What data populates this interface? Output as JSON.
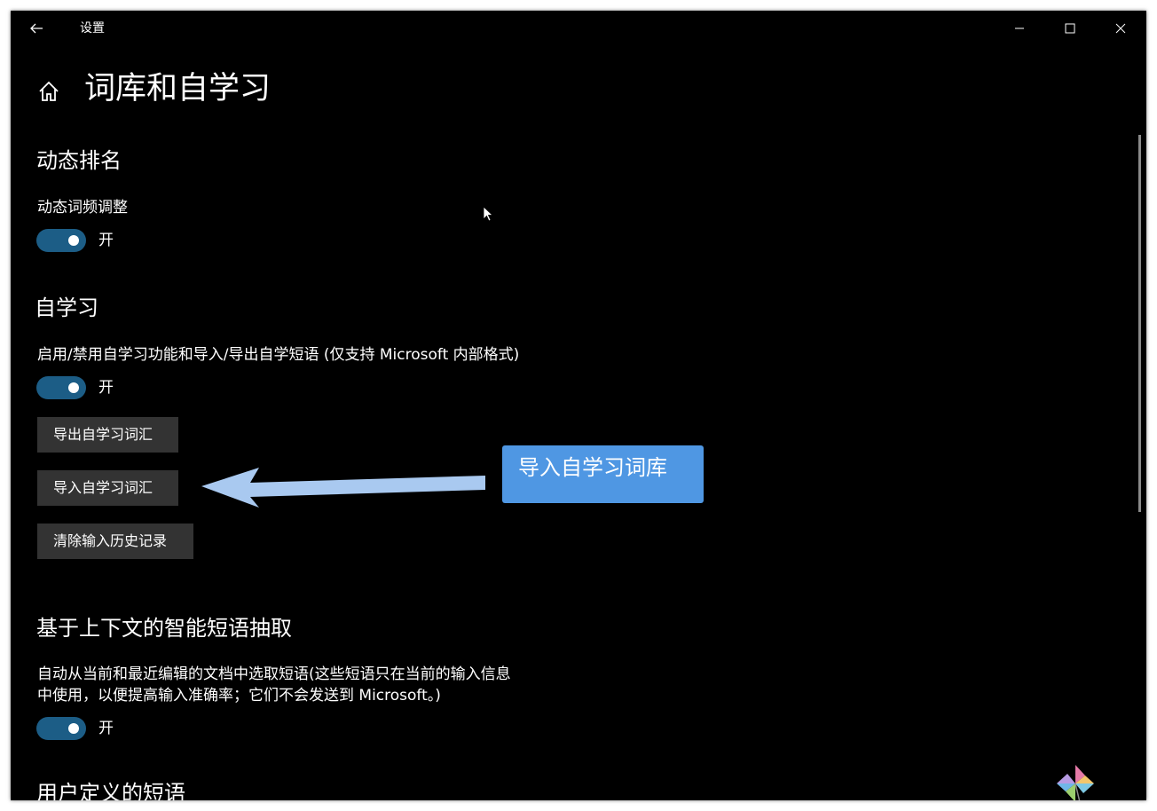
{
  "window": {
    "title": "设置"
  },
  "page": {
    "title": "词库和自学习"
  },
  "dynamic_ranking": {
    "heading": "动态排名",
    "setting_label": "动态词频调整",
    "toggle_state": "开"
  },
  "self_learning": {
    "heading": "自学习",
    "setting_label": "启用/禁用自学习功能和导入/导出自学短语 (仅支持 Microsoft 内部格式)",
    "toggle_state": "开",
    "export_button": "导出自学习词汇",
    "import_button": "导入自学习词汇",
    "clear_button": "清除输入历史记录"
  },
  "context_phrases": {
    "heading": "基于上下文的智能短语抽取",
    "description_line1": "自动从当前和最近编辑的文档中选取短语(这些短语只在当前的输入信息",
    "description_line2": "中使用，以便提高输入准确率；它们不会发送到 Microsoft。)",
    "toggle_state": "开"
  },
  "user_defined": {
    "heading": "用户定义的短语"
  },
  "annotation": {
    "text": "导入自学习词库",
    "color": "#4f97e3"
  },
  "colors": {
    "toggle_on": "#1c5d86",
    "button_bg": "#333333",
    "arrow": "#a9c9f0"
  },
  "icons": {
    "back": "back-arrow-icon",
    "home": "home-icon",
    "minimize": "minimize-icon",
    "maximize": "maximize-icon",
    "close": "close-icon"
  }
}
